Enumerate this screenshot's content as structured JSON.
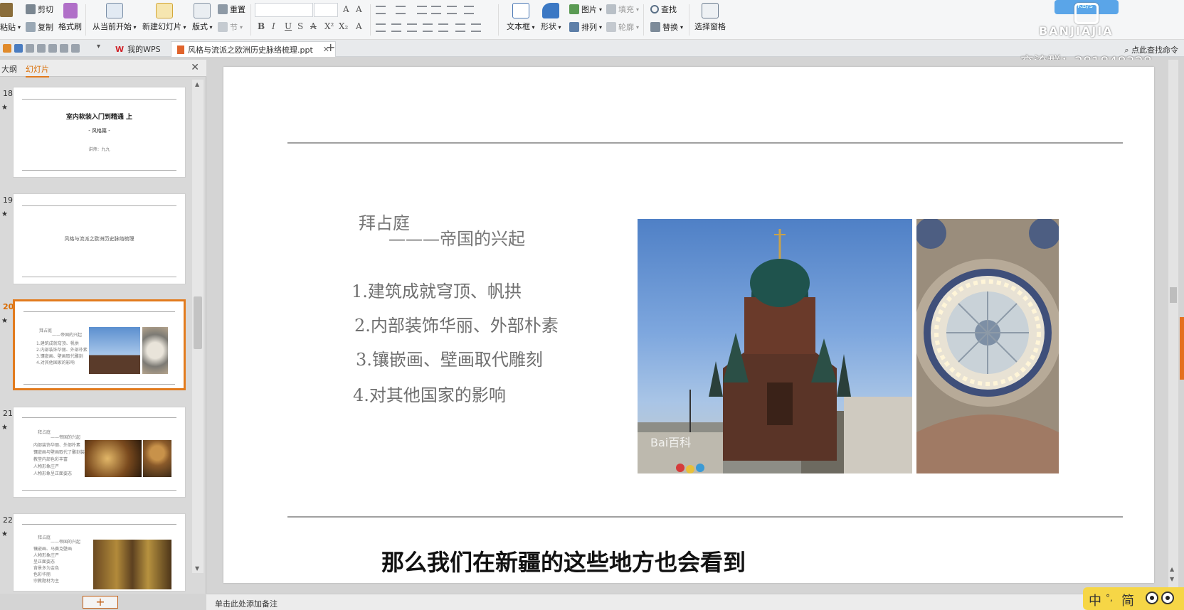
{
  "ribbon": {
    "paste": "粘贴",
    "cut": "剪切",
    "copy": "复制",
    "format_painter": "格式刷",
    "from_current": "从当前开始",
    "new_slide": "新建幻灯片",
    "layout": "版式",
    "section": "节",
    "reset": "重置",
    "textbox": "文本框",
    "shape": "形状",
    "picture": "图片",
    "fill": "填充",
    "arrange": "排列",
    "outline": "轮廓",
    "find": "查找",
    "replace": "替换",
    "selection_pane": "选择窗格"
  },
  "brand": {
    "name": "BANJIAJIA",
    "speed": "KB/s",
    "group": "交流群：281848328"
  },
  "tabbar": {
    "wps_tab": "我的WPS",
    "doc_tab": "风格与流派之欧洲历史脉络梳理.ppt",
    "search_cmd": "点此查找命令"
  },
  "panel": {
    "tab_outline": "大纲",
    "tab_slides": "幻灯片",
    "slides": [
      {
        "number": "18",
        "title": "室内软装入门到精通 上",
        "subtitle": "- 风格篇 -",
        "author": "讲师：九九"
      },
      {
        "number": "19",
        "title": "风格与流派之欧洲历史脉络梳理"
      },
      {
        "number": "20",
        "title": "拜占庭",
        "subtitle": "——帝国的兴起",
        "lines": [
          "1.建筑成就穹顶、帆拱",
          "2.内部装饰华丽、外部朴素",
          "3.镶嵌画、壁画取代雕刻",
          "4.对其他国家的影响"
        ]
      },
      {
        "number": "21",
        "title": "拜占庭",
        "subtitle": "——帝国的兴起",
        "lines": [
          "内部装饰华丽、外部朴素",
          "镶嵌画与壁画取代了雕刻装饰",
          "教堂内部色彩丰富",
          "人物形象庄严",
          "人物形象呈正面姿态"
        ]
      },
      {
        "number": "22",
        "title": "拜占庭",
        "subtitle": "——帝国的兴起",
        "lines": [
          "镶嵌画、马赛克壁画",
          "人物形象庄严",
          "呈正面姿态",
          "背景多为金色",
          "色彩华丽",
          "宗教题材为主"
        ]
      }
    ]
  },
  "slide": {
    "title_line1": "拜占庭",
    "title_line2": "———帝国的兴起",
    "bullets": [
      "1.建筑成就穹顶、帆拱",
      "2.内部装饰华丽、外部朴素",
      "3.镶嵌画、壁画取代雕刻",
      "4.对其他国家的影响"
    ],
    "watermark": "Bai百科"
  },
  "caption": "那么我们在新疆的这些地方也会看到",
  "status": {
    "notes_placeholder": "单击此处添加备注"
  },
  "ime": {
    "lang": "中",
    "punct": "°,",
    "mode": "简"
  }
}
